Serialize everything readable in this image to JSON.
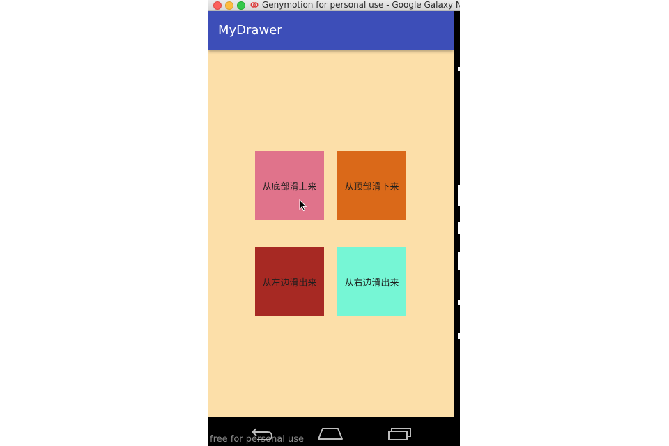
{
  "window": {
    "title": "Genymotion for personal use - Google Galaxy Nexus"
  },
  "app": {
    "title": "MyDrawer"
  },
  "tiles": [
    {
      "label": "从底部滑上来",
      "color": "#e0738b"
    },
    {
      "label": "从顶部滑下来",
      "color": "#da6919"
    },
    {
      "label": "从左边滑出来",
      "color": "#a72923"
    },
    {
      "label": "从右边滑出来",
      "color": "#76f6d5"
    }
  ],
  "navbar": {
    "watermark": "free for personal use",
    "buttons": [
      "back-icon",
      "home-icon",
      "recents-icon"
    ]
  },
  "colors": {
    "appbar": "#3d4eb8",
    "background": "#fcdfa9"
  }
}
